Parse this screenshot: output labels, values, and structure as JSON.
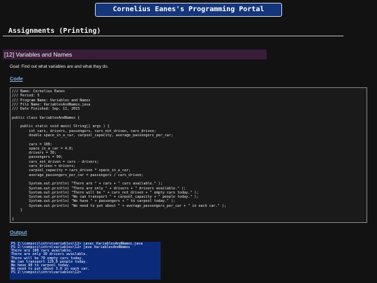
{
  "header": {
    "title": "Cornelius Eanes's Programming Portal"
  },
  "section": {
    "title": "Assignments (Printing)"
  },
  "assignment": {
    "title": "[12] Variables and Names"
  },
  "goal": "Goal: Find out what variables are and what they do.",
  "code_link": "Code",
  "output_link": "Output",
  "code_lines": [
    "/// Name: Cornelius Eanes",
    "/// Period: 5",
    "/// Program Name: Variables and Names",
    "/// File Name: VariablesAndNames.java",
    "/// Date Finished: Sep. 11, 2015",
    "",
    "public class VariablesAndNames {",
    "",
    "    public static void main( String[] args ) {",
    "        int cars, drivers, passengers, cars_not_driven, cars_driven;",
    "        double space_in_a_car, carpool_capacity, average_passengers_per_car;",
    "",
    "        cars = 100;",
    "        space_in_a_car = 4.0;",
    "        drivers = 30;",
    "        passengers = 90;",
    "        cars_not_driven = cars - drivers;",
    "        cars_driven = drivers;",
    "        carpool_capacity = cars_driven * space_in_a_car;",
    "        average_passengers_per_car = passengers / cars_driven;",
    "",
    "        System.out.println( \"There are \" + cars + \" cars available.\" );",
    "        System.out.println( \"There are only \" + drivers + \" drivers available.\" );",
    "        System.out.println( \"There will be \" + cars_not_driven + \" empty cars today.\" );",
    "        System.out.println( \"We can transport \" + carpool_capacity + \" people today.\" );",
    "        System.out.println( \"We have \" + passengers + \" to carpool today.\" );",
    "        System.out.println( \"We need to put about \" + average_passengers_per_car + \" in each car.\" );",
    "    }",
    "",
    "}"
  ],
  "output_lines": [
    "PS Z:\\compsci\\intro\\variables\\12> javac VariablesAndNames.java",
    "PS Z:\\compsci\\intro\\variables\\12> java VariablesAndNames",
    "There are 100 cars available.",
    "There are only 30 drivers available.",
    "There will be 70 empty cars today.",
    "We can transport 120.0 people today.",
    "We have 90 to carpool today.",
    "We need to put about 3.0 in each car.",
    "PS Z:\\compsci\\intro\\variables\\12> "
  ]
}
